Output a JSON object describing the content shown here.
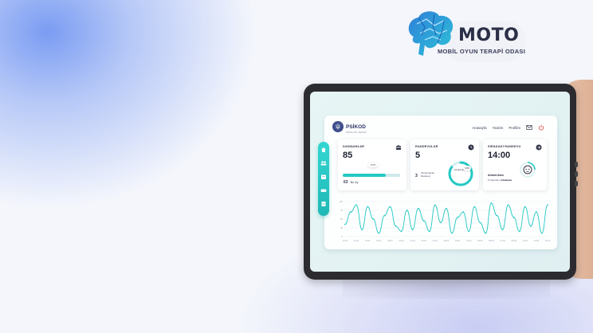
{
  "logo": {
    "title": "MOTO",
    "subtitle": "MOBİL OYUN TERAPİ ODASI",
    "brain_icon": "brain-icon"
  },
  "app": {
    "brand": {
      "name": "PSİKOD",
      "tagline": "PSİKOLOJİK | DESTEK"
    },
    "nav": {
      "home": "Anasayfa",
      "help": "Yardım",
      "profile": "Profilim"
    },
    "header_icons": [
      "mail-icon",
      "power-icon"
    ],
    "sidebar_icons": [
      "home-icon",
      "users-icon",
      "calendar-icon",
      "gamepad-icon",
      "document-icon"
    ],
    "colors": {
      "accent": "#25c9c4",
      "accent_dark": "#1fb8b6",
      "text": "#1d2130"
    },
    "clients_card": {
      "title": "DANIŞANLAR",
      "value": "85",
      "progress_label": "%75",
      "progress_fraction": 0.75,
      "month_count": "63",
      "month_label": "Bu Ay",
      "icon": "group-icon"
    },
    "appointments_card": {
      "title": "RANDEVULAR",
      "value": "5",
      "completed_count": "3",
      "completed_label": "Tamamlanan Randevu",
      "ring_label": "Günlük Hedef",
      "ring_percent_label": "%85",
      "ring_fraction": 0.85,
      "icon": "clock-icon"
    },
    "next_card": {
      "title": "SIRADAKİ RANDEVU",
      "time": "14:00",
      "person": "Ahmet Akın",
      "age": "8 Yaşında",
      "role": "Arkadaşla",
      "icon": "arrow-right-icon"
    }
  },
  "chart_data": {
    "type": "line",
    "x": [
      "10.01",
      "11.01",
      "12.01",
      "13.01",
      "14.01",
      "15.01",
      "16.01",
      "17.01",
      "18.01",
      "19.01",
      "20.01",
      "21.01",
      "22.01",
      "23.01",
      "24.01",
      "25.01",
      "26.01",
      "27.01",
      "28.01",
      "29.01",
      "30.01",
      "31.01",
      "01.02",
      "02.02",
      "03.02",
      "04.02",
      "05.02",
      "06.02",
      "07.02",
      "08.02",
      "09.02",
      "10.02",
      "11.02",
      "12.02",
      "13.02",
      "14.02",
      "15.02"
    ],
    "y_ticks": [
      "0",
      "25",
      "50",
      "75",
      "100"
    ],
    "ylim": [
      0,
      100
    ],
    "series": [
      {
        "values": [
          35,
          70,
          90,
          20,
          85,
          50,
          10,
          60,
          85,
          30,
          15,
          75,
          20,
          80,
          45,
          15,
          90,
          40,
          80,
          10,
          55,
          70,
          15,
          85,
          40,
          10,
          95,
          60,
          20,
          90,
          55,
          15,
          85,
          30,
          70,
          10,
          90
        ]
      }
    ],
    "grid": true,
    "legend": "none"
  }
}
